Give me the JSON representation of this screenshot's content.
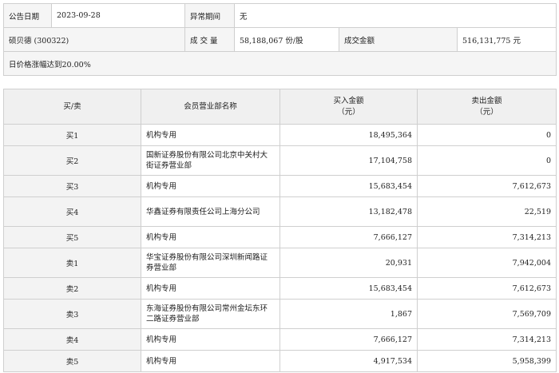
{
  "info": {
    "date_label": "公告日期",
    "date_value": "2023-09-28",
    "period_label": "异常期间",
    "period_value": "无",
    "stock": "硕贝德 (300322)",
    "volume_label": "成 交 量",
    "volume_value": "58,188,067 份/股",
    "amount_label": "成交金额",
    "amount_value": "516,131,775 元",
    "reason": "日价格涨幅达到20.00%"
  },
  "trades": {
    "headers": {
      "side": "买/卖",
      "name": "会员营业部名称",
      "buy": "买入金额\n（元）",
      "sell": "卖出金额\n（元）"
    },
    "rows": [
      {
        "side": "买1",
        "name": "机构专用",
        "buy": "18,495,364",
        "sell": "0"
      },
      {
        "side": "买2",
        "name": "国新证券股份有限公司北京中关村大街证券营业部",
        "buy": "17,104,758",
        "sell": "0"
      },
      {
        "side": "买3",
        "name": "机构专用",
        "buy": "15,683,454",
        "sell": "7,612,673"
      },
      {
        "side": "买4",
        "name": "华鑫证券有限责任公司上海分公司",
        "buy": "13,182,478",
        "sell": "22,519"
      },
      {
        "side": "买5",
        "name": "机构专用",
        "buy": "7,666,127",
        "sell": "7,314,213"
      },
      {
        "side": "卖1",
        "name": "华宝证券股份有限公司深圳新闻路证券营业部",
        "buy": "20,931",
        "sell": "7,942,004"
      },
      {
        "side": "卖2",
        "name": "机构专用",
        "buy": "15,683,454",
        "sell": "7,612,673"
      },
      {
        "side": "卖3",
        "name": "东海证券股份有限公司常州金坛东环二路证券营业部",
        "buy": "1,867",
        "sell": "7,569,709"
      },
      {
        "side": "卖4",
        "name": "机构专用",
        "buy": "7,666,127",
        "sell": "7,314,213"
      },
      {
        "side": "卖5",
        "name": "机构专用",
        "buy": "4,917,534",
        "sell": "5,958,399"
      }
    ]
  }
}
